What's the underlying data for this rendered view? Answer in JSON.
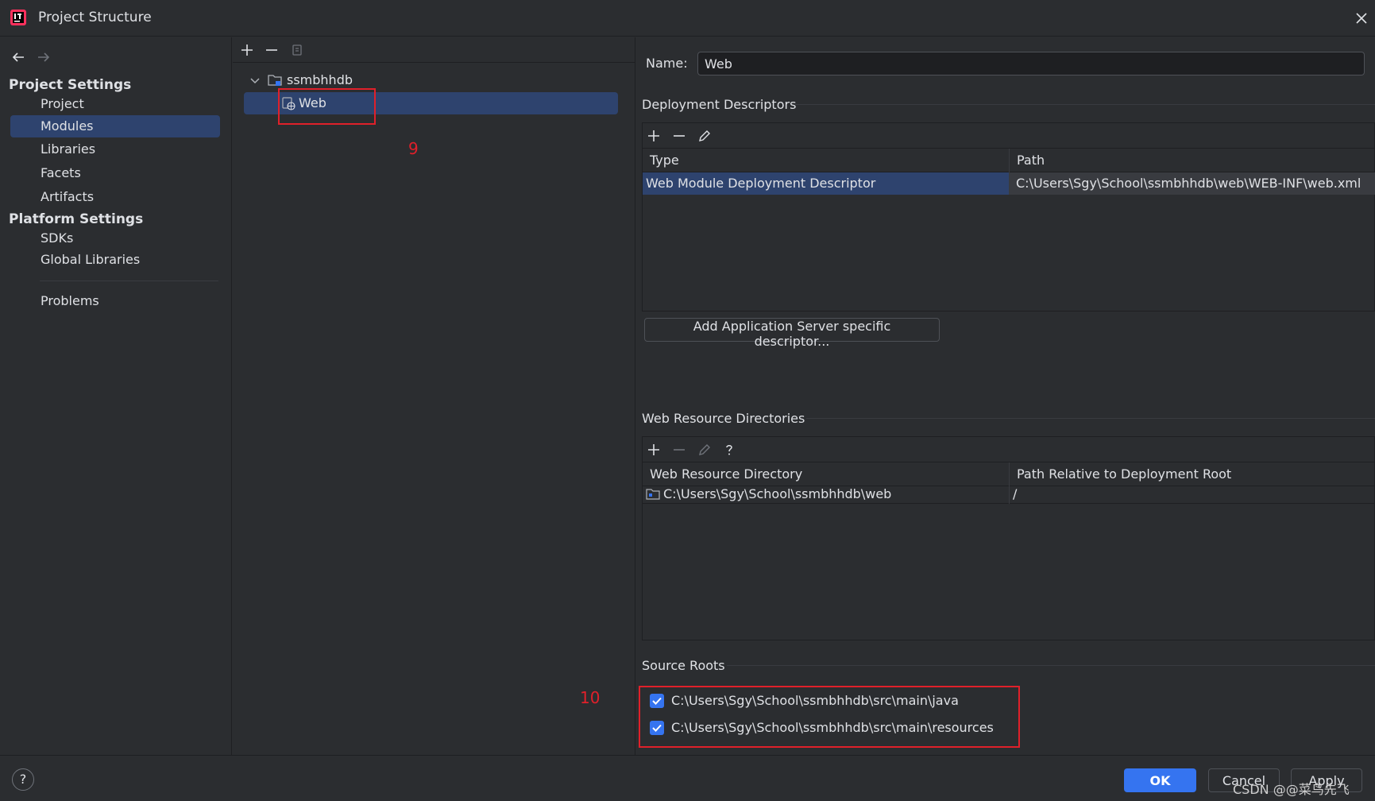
{
  "window": {
    "title": "Project Structure"
  },
  "sidebar": {
    "project_settings": "Project Settings",
    "items_project": [
      {
        "label": "Project"
      },
      {
        "label": "Modules"
      },
      {
        "label": "Libraries"
      },
      {
        "label": "Facets"
      },
      {
        "label": "Artifacts"
      }
    ],
    "platform_settings": "Platform Settings",
    "items_platform": [
      {
        "label": "SDKs"
      },
      {
        "label": "Global Libraries"
      }
    ],
    "problems": "Problems",
    "selected": "Modules"
  },
  "tree": {
    "root": "ssmbhhdb",
    "child": "Web"
  },
  "detail": {
    "name_label": "Name:",
    "name_value": "Web",
    "deployment_descriptors": {
      "title": "Deployment Descriptors",
      "columns": [
        "Type",
        "Path"
      ],
      "rows": [
        {
          "type": "Web Module Deployment Descriptor",
          "path": "C:\\Users\\Sgy\\School\\ssmbhhdb\\web\\WEB-INF\\web.xml"
        }
      ],
      "add_server_button": "Add Application Server specific descriptor..."
    },
    "web_resource_directories": {
      "title": "Web Resource Directories",
      "columns": [
        "Web Resource Directory",
        "Path Relative to Deployment Root"
      ],
      "rows": [
        {
          "directory": "C:\\Users\\Sgy\\School\\ssmbhhdb\\web",
          "relative": "/"
        }
      ]
    },
    "source_roots": {
      "title": "Source Roots",
      "items": [
        {
          "path": "C:\\Users\\Sgy\\School\\ssmbhhdb\\src\\main\\java",
          "checked": true
        },
        {
          "path": "C:\\Users\\Sgy\\School\\ssmbhhdb\\src\\main\\resources",
          "checked": true
        }
      ]
    }
  },
  "annotations": {
    "a9": "9",
    "a10": "10"
  },
  "footer": {
    "help": "?",
    "ok": "OK",
    "cancel": "Cancel",
    "apply": "Apply",
    "watermark": "CSDN @@菜鸟先飞"
  },
  "colors": {
    "background": "#2b2d30",
    "selection": "#2e436e",
    "accent": "#3574f0",
    "annotation": "#e0202a"
  }
}
